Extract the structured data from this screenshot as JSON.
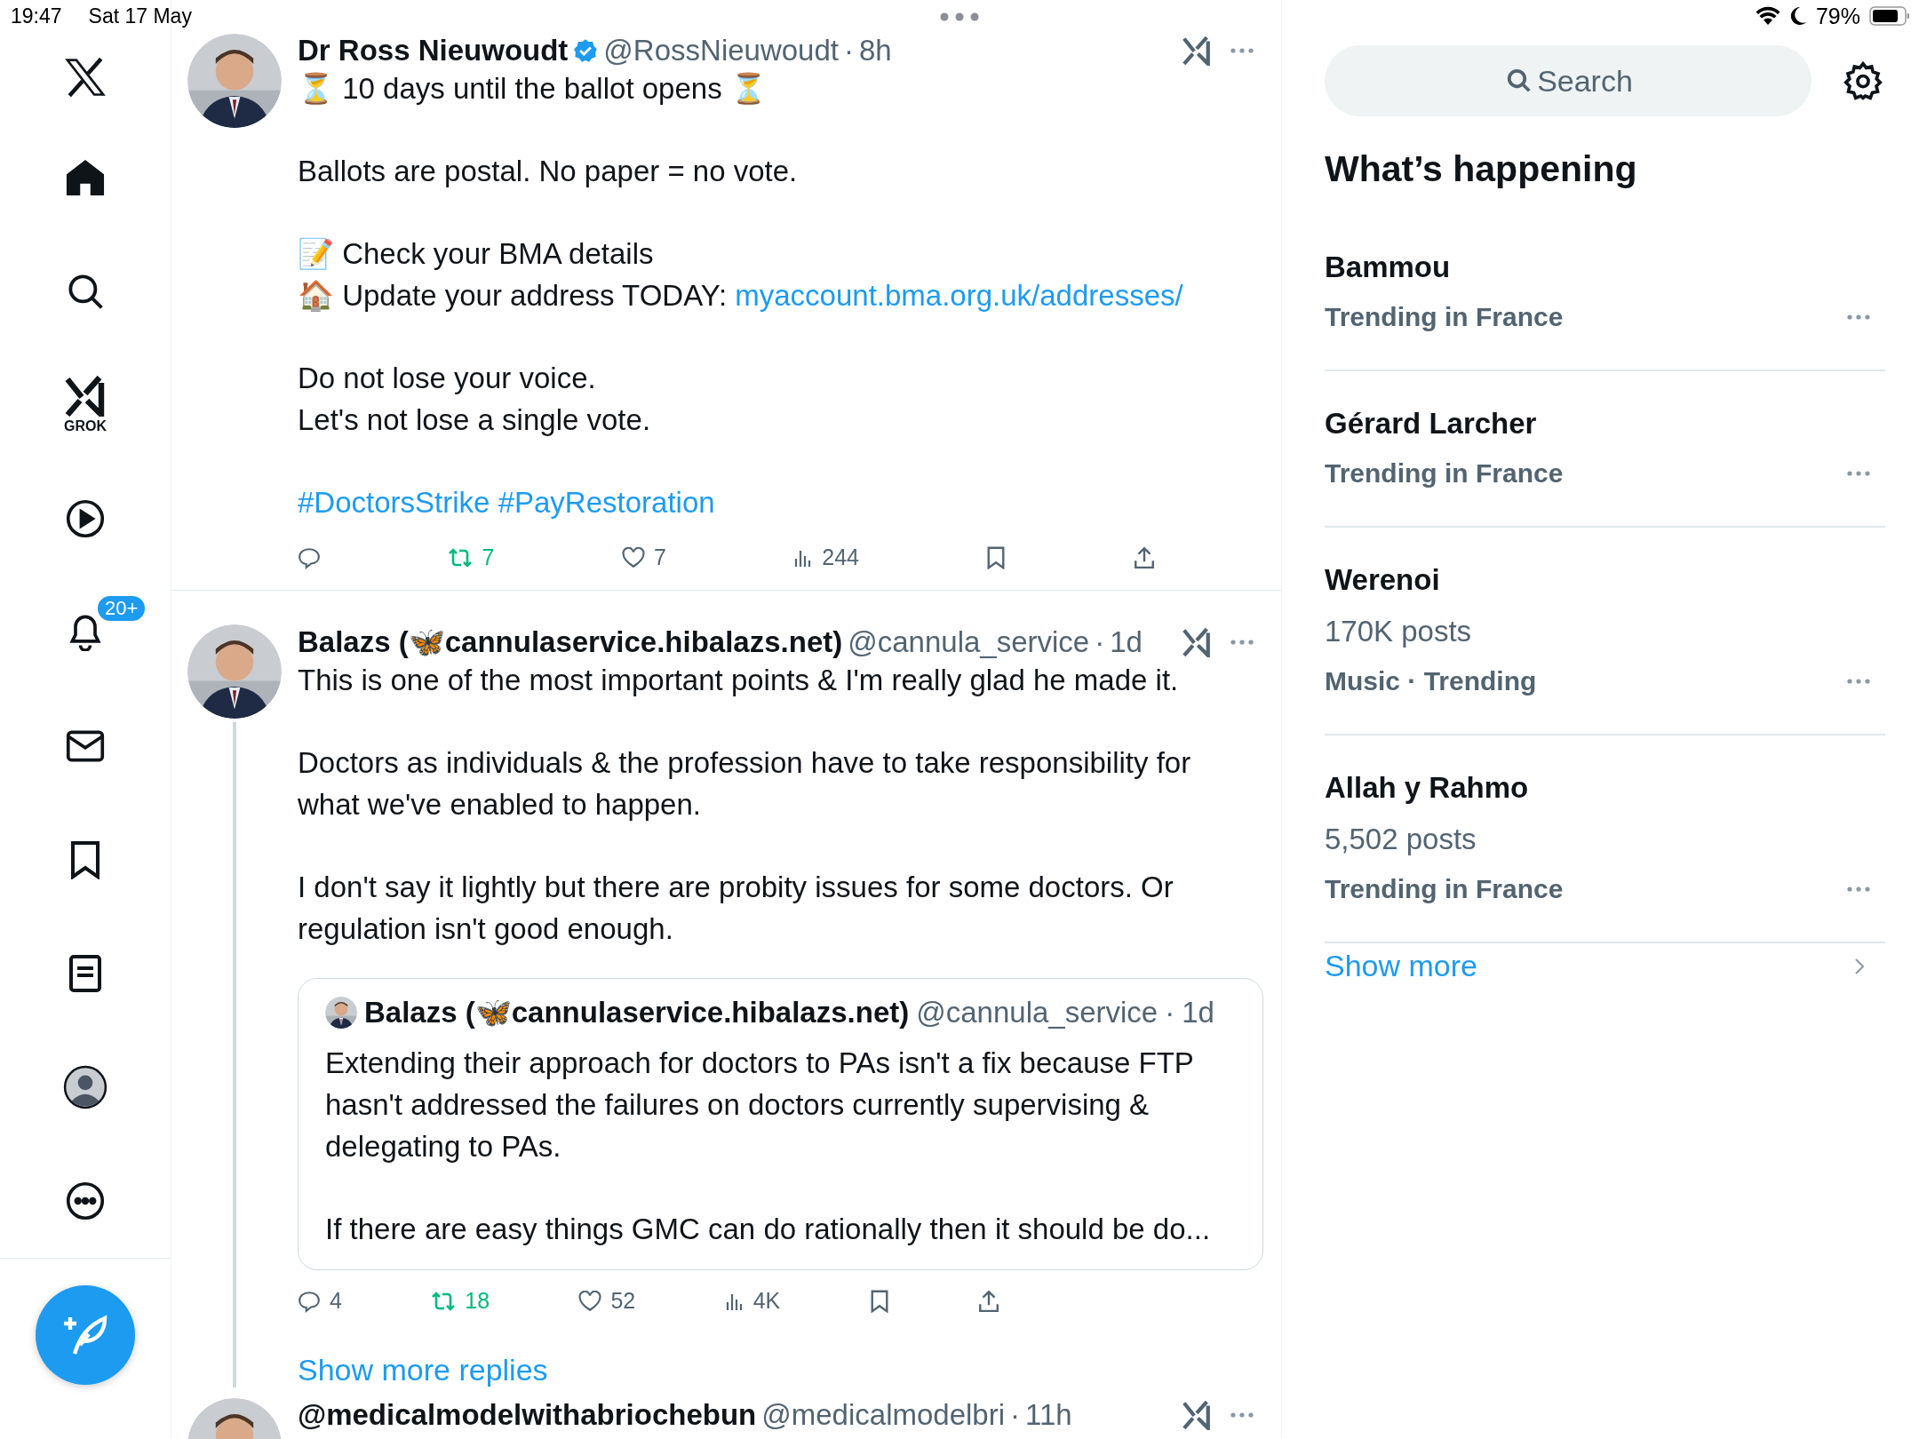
{
  "status_bar": {
    "time": "19:47",
    "date": "Sat 17 May",
    "battery": "79%"
  },
  "sidebar": {
    "grok_label": "GROK",
    "notification_badge": "20+",
    "nav": [
      {
        "kind": "home"
      },
      {
        "kind": "search"
      },
      {
        "kind": "grok"
      },
      {
        "kind": "video"
      },
      {
        "kind": "notifications"
      },
      {
        "kind": "messages"
      },
      {
        "kind": "bookmarks"
      },
      {
        "kind": "lists"
      },
      {
        "kind": "profile"
      },
      {
        "kind": "more"
      }
    ]
  },
  "tweets": [
    {
      "author": "Dr Ross Nieuwoudt",
      "verified": true,
      "handle": "@RossNieuwoudt",
      "separator": "·",
      "time": "8h",
      "thread": false,
      "paragraphs": [
        [
          [
            {
              "kind": "text",
              "text": "⏳ 10 days until the ballot opens ⏳"
            }
          ]
        ],
        [
          [
            {
              "kind": "text",
              "text": "Ballots are postal. No paper = no vote."
            }
          ]
        ],
        [
          [
            {
              "kind": "text",
              "text": "📝 Check your BMA details"
            }
          ],
          [
            {
              "kind": "text",
              "text": "🏠 Update your address TODAY: "
            },
            {
              "kind": "link",
              "text": "myaccount.bma.org.uk/addresses/"
            }
          ]
        ],
        [
          [
            {
              "kind": "text",
              "text": "Do not lose your voice."
            }
          ],
          [
            {
              "kind": "text",
              "text": "Let's not lose a single vote."
            }
          ]
        ],
        [
          [
            {
              "kind": "link",
              "text": "#DoctorsStrike"
            },
            {
              "kind": "link",
              "text": "#PayRestoration"
            }
          ]
        ]
      ],
      "actions": [
        {
          "kind": "reply",
          "active": false
        },
        {
          "kind": "repost",
          "count": "7",
          "active": true
        },
        {
          "kind": "like",
          "count": "7",
          "active": false
        },
        {
          "kind": "views",
          "count": "244",
          "active": false
        },
        {
          "kind": "bookmark",
          "active": false
        },
        {
          "kind": "share",
          "active": false
        }
      ]
    },
    {
      "author": "Balazs (🦋cannulaservice.hibalazs.net)",
      "verified": false,
      "handle": "@cannula_service",
      "separator": "·",
      "time": "1d",
      "thread": true,
      "paragraphs": [
        [
          [
            {
              "kind": "text",
              "text": "This is one of the most important points & I'm really glad he made it."
            }
          ]
        ],
        [
          [
            {
              "kind": "text",
              "text": "Doctors as individuals & the profession have to take responsibility for what we've enabled to happen."
            }
          ]
        ],
        [
          [
            {
              "kind": "text",
              "text": "I don't say it lightly but there are probity issues for some doctors. Or regulation isn't good enough."
            }
          ]
        ]
      ],
      "quote": {
        "author": "Balazs (🦋cannulaservice.hibalazs.net)",
        "handle": "@cannula_service",
        "separator": "·",
        "time": "1d",
        "paragraphs": [
          "Extending their approach for doctors to PAs isn't a fix because FTP hasn't addressed the failures on doctors currently supervising & delegating to PAs.",
          "If there are easy things GMC can do rationally then it should be do..."
        ]
      },
      "actions": [
        {
          "kind": "reply",
          "count": "4",
          "active": false
        },
        {
          "kind": "repost",
          "count": "18",
          "active": true
        },
        {
          "kind": "like",
          "count": "52",
          "active": false
        },
        {
          "kind": "views",
          "count": "4K",
          "active": false
        },
        {
          "kind": "bookmark",
          "active": false
        },
        {
          "kind": "share",
          "active": false
        }
      ],
      "show_more_replies": "Show more replies"
    },
    {
      "author": "@medicalmodelwithabriochebun",
      "verified": false,
      "handle": "@medicalmodelbri",
      "separator": "·",
      "time": "11h"
    }
  ],
  "right_panel": {
    "search": {
      "placeholder": "Search"
    },
    "heading": "What’s happening",
    "trends": [
      {
        "title": "Bammou",
        "meta": "Trending in France"
      },
      {
        "title": "Gérard Larcher",
        "meta": "Trending in France"
      },
      {
        "title": "Werenoi",
        "posts": "170K posts",
        "meta": "Music · Trending"
      },
      {
        "title": "Allah y Rahmo",
        "posts": "5,502 posts",
        "meta": "Trending in France"
      }
    ],
    "show_more": "Show more"
  }
}
